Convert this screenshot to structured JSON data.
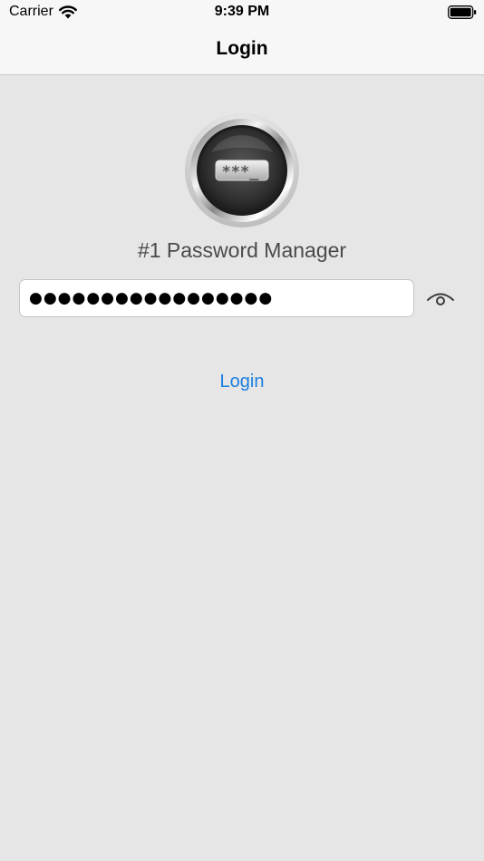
{
  "status_bar": {
    "carrier": "Carrier",
    "time": "9:39 PM",
    "wifi_icon": "wifi-icon",
    "battery_icon": "battery-full-icon"
  },
  "nav": {
    "title": "Login"
  },
  "app": {
    "logo_icon": "password-manager-logo-icon",
    "logo_text": "***_",
    "subtitle": "#1 Password Manager"
  },
  "password": {
    "masked_value": "●●●●●●●●●●●●●●●●●",
    "toggle_icon": "eye-icon"
  },
  "actions": {
    "login_label": "Login"
  },
  "colors": {
    "background": "#e6e6e7",
    "bar": "#f7f7f7",
    "accent": "#1a7fe0"
  }
}
